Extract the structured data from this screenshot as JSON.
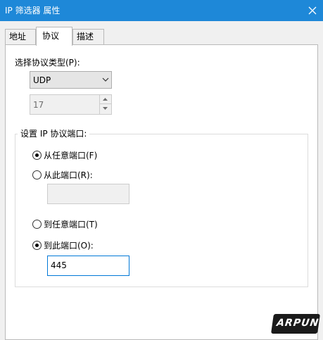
{
  "window": {
    "title": "IP 筛选器 属性",
    "close_icon": "close-icon",
    "title_bar_color": "#1e88d8"
  },
  "tabs": [
    {
      "label": "地址",
      "selected": false
    },
    {
      "label": "协议",
      "selected": true
    },
    {
      "label": "描述",
      "selected": false
    }
  ],
  "protocol": {
    "type_label": "选择协议类型(P):",
    "type_value": "UDP",
    "number_value": "17"
  },
  "ports": {
    "group_title": "设置 IP 协议端口:",
    "from_any": {
      "label": "从任意端口(F)",
      "checked": true
    },
    "from_this": {
      "label": "从此端口(R):",
      "checked": false,
      "value": ""
    },
    "to_any": {
      "label": "到任意端口(T)",
      "checked": false
    },
    "to_this": {
      "label": "到此端口(O):",
      "checked": true,
      "value": "445"
    }
  },
  "watermark": {
    "text": "ARPUN"
  },
  "colors": {
    "accent": "#0078d7",
    "panel_bg": "#ffffff",
    "dialog_bg": "#f0f0f0"
  }
}
